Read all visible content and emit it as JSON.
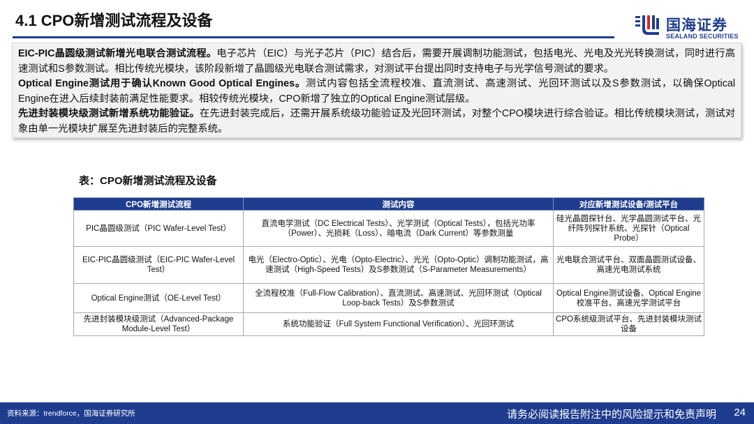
{
  "page_title": "4.1 CPO新增测试流程及设备",
  "logo": {
    "cn": "国海证券",
    "en": "SEALAND SECURITIES"
  },
  "summary": [
    {
      "bold": "EIC-PIC晶圆级测试新增光电联合测试流程。",
      "text": "电子芯片（EIC）与光子芯片（PIC）结合后，需要开展调制功能测试，包括电光、光电及光光转换测试，同时进行高速测试和S参数测试。相比传统光模块，该阶段新增了晶圆级光电联合测试需求，对测试平台提出同时支持电子与光学信号测试的要求。"
    },
    {
      "bold": "Optical Engine测试用于确认Known Good Optical Engines。",
      "text": "测试内容包括全流程校准、直流测试、高速测试、光回环测试以及S参数测试，以确保Optical Engine在进入后续封装前满足性能要求。相较传统光模块，CPO新增了独立的Optical Engine测试层级。"
    },
    {
      "bold": "先进封装模块级测试新增系统功能验证。",
      "text": "在先进封装完成后，还需开展系统级功能验证及光回环测试，对整个CPO模块进行综合验证。相比传统模块测试，测试对象由单一光模块扩展至先进封装后的完整系统。"
    }
  ],
  "table": {
    "caption": "表：CPO新增测试流程及设备",
    "headers": [
      "CPO新增测试流程",
      "测试内容",
      "对应新增测试设备/测试平台"
    ],
    "rows": [
      [
        "PIC晶圆级测试（PIC Wafer-Level Test）",
        "直流电学测试（DC Electrical Tests）、光学测试（Optical Tests），包括光功率（Power）、光损耗（Loss）、暗电流（Dark Current）等参数测量",
        "硅光晶圆探针台、光学晶圆测试平台、光纤阵列探针系统、光探针（Optical Probe）"
      ],
      [
        "EIC-PIC晶圆级测试（EIC-PIC Wafer-Level Test）",
        "电光（Electro-Optic）、光电（Opto-Electric）、光光（Opto-Optic）调制功能测试，高速测试（High-Speed Tests）及S参数测试（S-Parameter Measurements）",
        "光电联合测试平台、双面晶圆测试设备、高速光电测试系统"
      ],
      [
        "Optical Engine测试（OE-Level Test）",
        "全流程校准（Full-Flow Calibration）、直流测试、高速测试、光回环测试（Optical Loop-back Tests）及S参数测试",
        "Optical Engine测试设备、Optical Engine校准平台、高速光学测试平台"
      ],
      [
        "先进封装模块级测试（Advanced-Package Module-Level Test）",
        "系统功能验证（Full System Functional Verification）、光回环测试",
        "CPO系统级测试平台、先进封装模块测试设备"
      ]
    ]
  },
  "footer": {
    "source": "资料来源：trendforce，国海证券研究所",
    "disclaimer": "请务必阅读报告附注中的风险提示和免责声明",
    "page_number": "24"
  },
  "colors": {
    "brand": "#1f3d8f",
    "brand_red": "#d7262b",
    "summary_bg": "#f2f2f2"
  }
}
